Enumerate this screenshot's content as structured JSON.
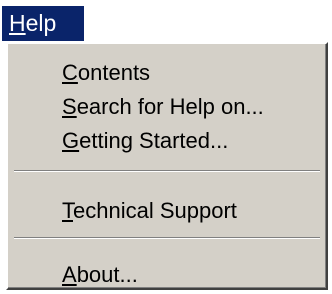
{
  "menu_bar": {
    "help": {
      "mnemonic": "H",
      "rest": "elp"
    }
  },
  "menu": {
    "items": [
      {
        "mnemonic": "C",
        "rest": "ontents"
      },
      {
        "mnemonic": "S",
        "rest": "earch for Help on..."
      },
      {
        "mnemonic": "G",
        "rest": "etting Started..."
      },
      {
        "mnemonic": "T",
        "rest": "echnical Support"
      },
      {
        "mnemonic": "A",
        "rest": "bout..."
      }
    ]
  },
  "colors": {
    "highlight": "#0a246a",
    "menu_face": "#d4d0c8",
    "text": "#000000",
    "highlight_text": "#ffffff"
  }
}
